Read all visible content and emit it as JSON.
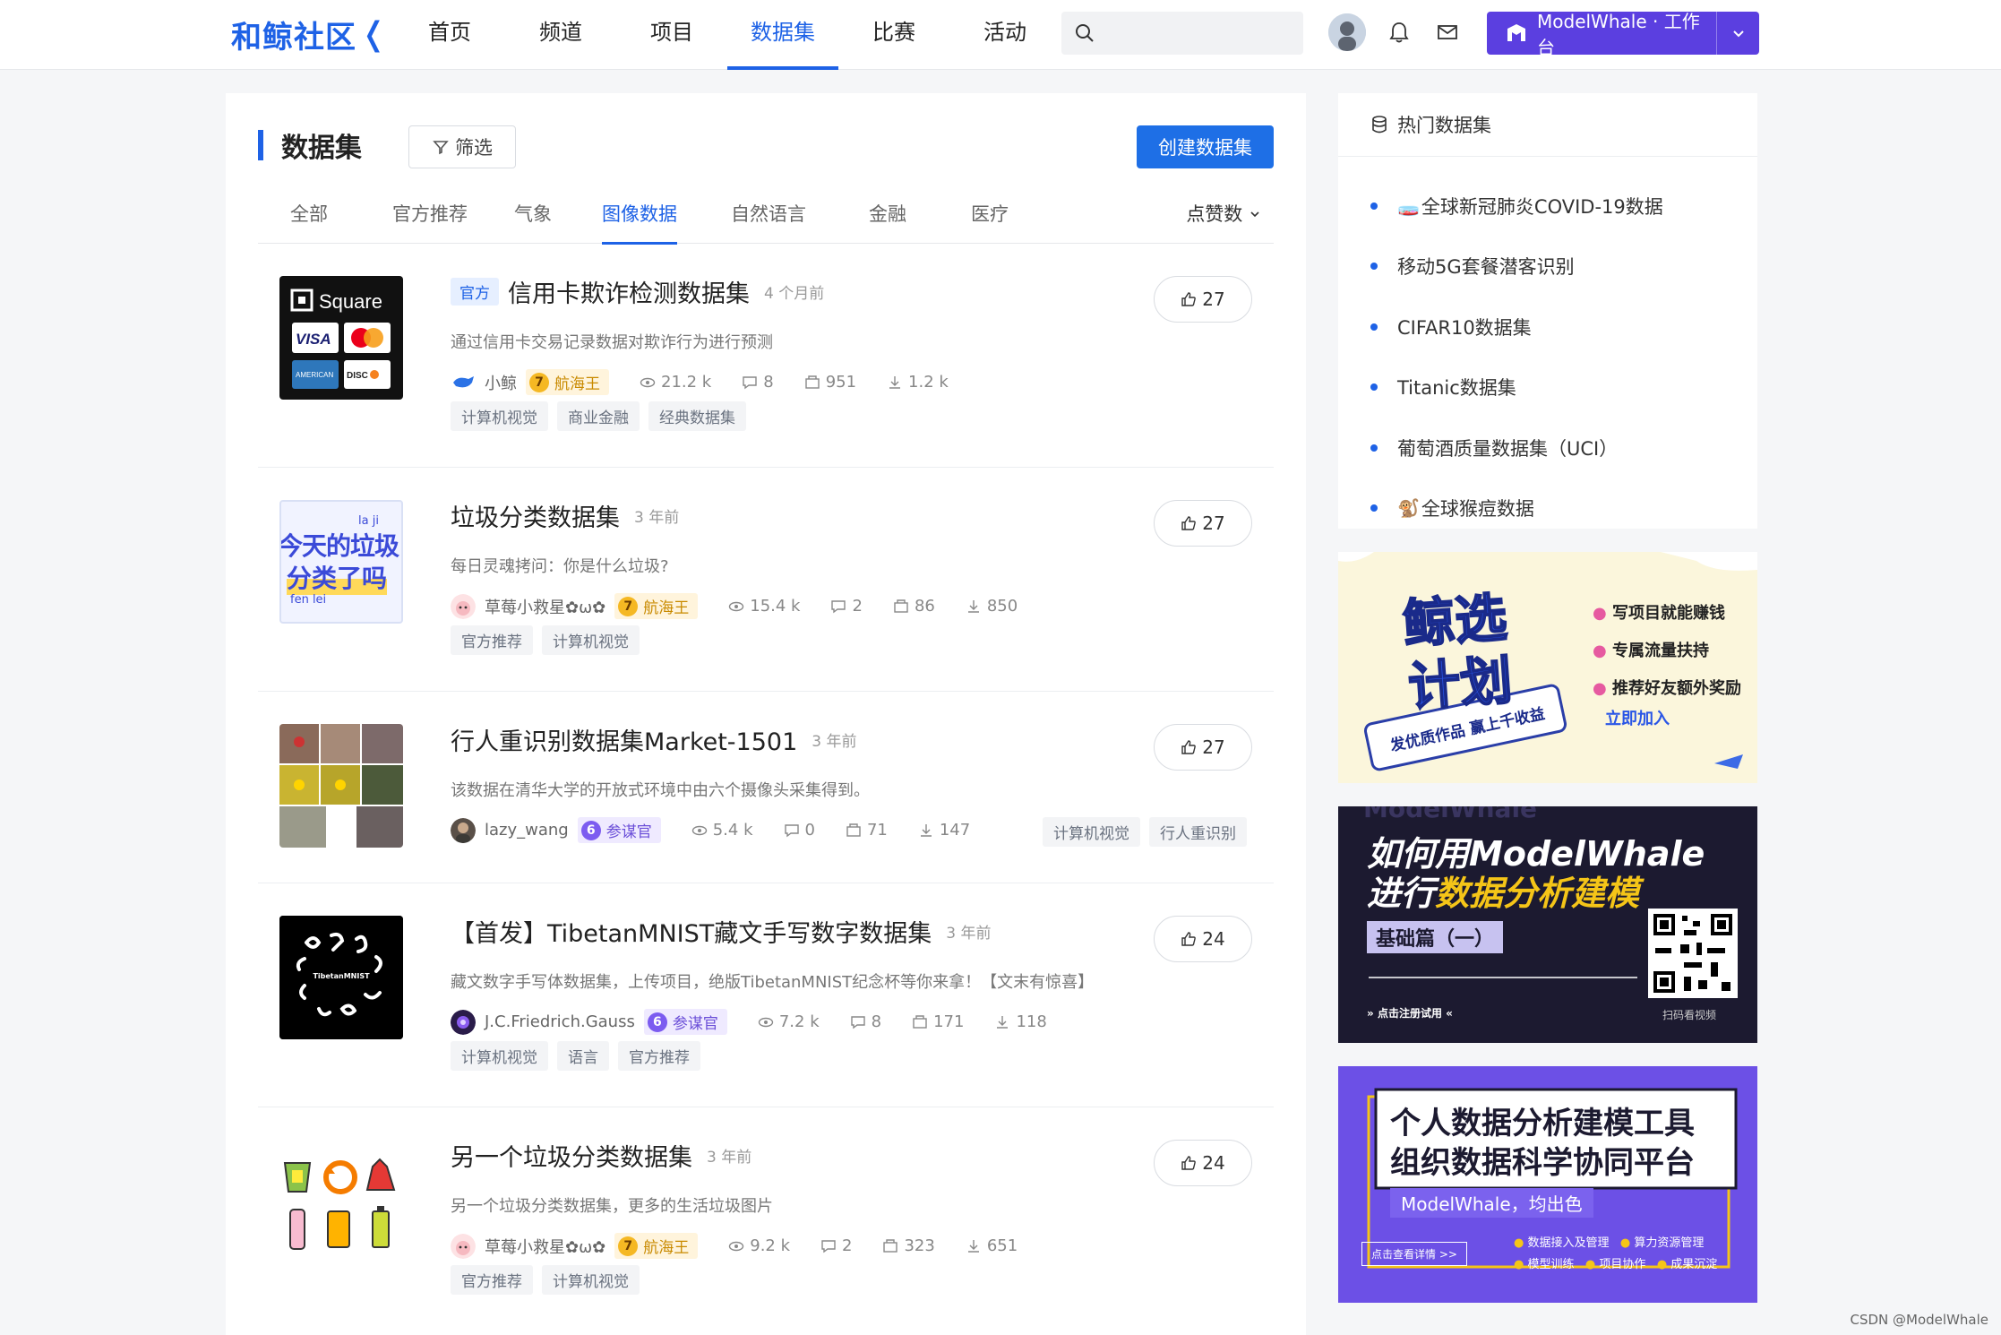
{
  "header": {
    "logo_text": "和鲸社区",
    "nav": [
      "首页",
      "频道",
      "项目",
      "数据集",
      "比赛",
      "活动"
    ],
    "active_nav": "数据集",
    "search_placeholder": "",
    "workbench_label": "ModelWhale · 工作台"
  },
  "main": {
    "title": "数据集",
    "filter_label": "筛选",
    "create_label": "创建数据集",
    "tabs": [
      "全部",
      "官方推荐",
      "气象",
      "图像数据",
      "自然语言",
      "金融",
      "医疗"
    ],
    "active_tab": "图像数据",
    "sort_label": "点赞数"
  },
  "datasets": [
    {
      "official": "官方",
      "name": "信用卡欺诈检测数据集",
      "time": "4 个月前",
      "desc": "通过信用卡交易记录数据对欺诈行为进行预测",
      "user": "小鲸",
      "level_num": "7",
      "level_name": "航海王",
      "views": "21.2 k",
      "comments": "8",
      "forks": "951",
      "downloads": "1.2 k",
      "tags": [
        "计算机视觉",
        "商业金融",
        "经典数据集"
      ],
      "likes": "27"
    },
    {
      "name": "垃圾分类数据集",
      "time": "3 年前",
      "desc": "每日灵魂拷问：你是什么垃圾?",
      "user": "草莓小救星✿ω✿",
      "level_num": "7",
      "level_name": "航海王",
      "views": "15.4 k",
      "comments": "2",
      "forks": "86",
      "downloads": "850",
      "tags": [
        "官方推荐",
        "计算机视觉"
      ],
      "likes": "27",
      "thumb_text": {
        "top": "la    ji",
        "main1": "今天的垃圾",
        "main2": "分类了吗",
        "bottom": "fen  lei"
      }
    },
    {
      "name": "行人重识别数据集Market-1501",
      "time": "3 年前",
      "desc": "该数据在清华大学的开放式环境中由六个摄像头采集得到。",
      "user": "lazy_wang",
      "level_num": "6",
      "level_name": "参谋官",
      "views": "5.4 k",
      "comments": "0",
      "forks": "71",
      "downloads": "147",
      "tags": [
        "计算机视觉",
        "行人重识别"
      ],
      "likes": "27"
    },
    {
      "name": "【首发】TibetanMNIST藏文手写数字数据集",
      "time": "3 年前",
      "desc": "藏文数字手写体数据集，上传项目，绝版TibetanMNIST纪念杯等你来拿！【文末有惊喜】",
      "user": "J.C.Friedrich.Gauss",
      "level_num": "6",
      "level_name": "参谋官",
      "views": "7.2 k",
      "comments": "8",
      "forks": "171",
      "downloads": "118",
      "tags": [
        "计算机视觉",
        "语言",
        "官方推荐"
      ],
      "likes": "24",
      "thumb_text": "TibetanMNIST"
    },
    {
      "name": "另一个垃圾分类数据集",
      "time": "3 年前",
      "desc": "另一个垃圾分类数据集，更多的生活垃圾图片",
      "user": "草莓小救星✿ω✿",
      "level_num": "7",
      "level_name": "航海王",
      "views": "9.2 k",
      "comments": "2",
      "forks": "323",
      "downloads": "651",
      "tags": [
        "官方推荐",
        "计算机视觉"
      ],
      "likes": "24"
    }
  ],
  "hot": {
    "title": "热门数据集",
    "items": [
      "全球新冠肺炎COVID-19数据",
      "移动5G套餐潜客识别",
      "CIFAR10数据集",
      "Titanic数据集",
      "葡萄酒质量数据集（UCI）",
      "全球猴痘数据"
    ]
  },
  "banners": {
    "b1": {
      "title1": "鲸选",
      "title2": "计划",
      "ribbon": "发优质作品  赢上千收益",
      "points": [
        "写项目就能赚钱",
        "专属流量扶持",
        "推荐好友额外奖励"
      ],
      "cta": "立即加入"
    },
    "b2": {
      "line1": "如何用ModelWhale",
      "line2a": "进行",
      "line2b": "数据分析建模",
      "badge": "基础篇（一）",
      "left_cta": "点击注册试用",
      "qr_caption": "扫码看视频",
      "watermark": "ModelWhale"
    },
    "b3": {
      "line1": "个人数据分析建模工具",
      "line2": "组织数据科学协同平台",
      "slogan": "ModelWhale，均出色",
      "cta": "点击查看详情 >>",
      "features": [
        "数据接入及管理",
        "算力资源管理",
        "模型训练",
        "项目协作",
        "成果沉淀"
      ]
    }
  },
  "credit": "CSDN @ModelWhale",
  "colors": {
    "brand": "#1e62e6",
    "workbench": "#5b3fe0",
    "gold": "#f5b823"
  }
}
